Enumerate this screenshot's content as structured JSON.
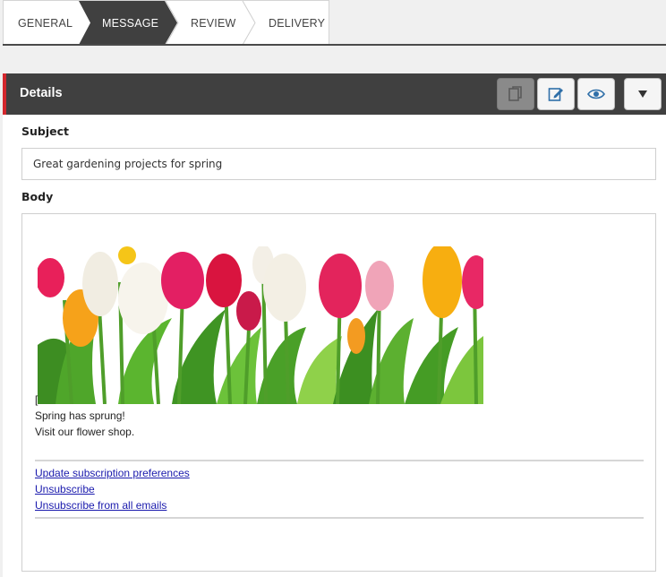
{
  "wizard": {
    "steps": [
      {
        "label": "GENERAL",
        "active": false
      },
      {
        "label": "MESSAGE",
        "active": true
      },
      {
        "label": "REVIEW",
        "active": false
      },
      {
        "label": "DELIVERY",
        "active": false
      }
    ]
  },
  "panel": {
    "title": "Details",
    "buttons": [
      {
        "icon": "copy-icon",
        "disabled": true
      },
      {
        "icon": "edit-icon",
        "disabled": false
      },
      {
        "icon": "eye-icon",
        "disabled": false
      },
      {
        "icon": "dropdown-arrow-icon",
        "disabled": false
      }
    ]
  },
  "form": {
    "subject_label": "Subject",
    "subject_value": "Great gardening projects for spring",
    "body_label": "Body"
  },
  "email_body": {
    "image": "tulips-banner",
    "bracket": "[",
    "lines": [
      "Spring has sprung!",
      "Visit our flower shop."
    ],
    "links": [
      "Update subscription preferences",
      "Unsubscribe",
      "Unsubscribe from all emails"
    ]
  },
  "colors": {
    "accent_red": "#d3272d",
    "header_dark": "#404040",
    "active_step": "#404040",
    "link": "#1a1aad"
  }
}
